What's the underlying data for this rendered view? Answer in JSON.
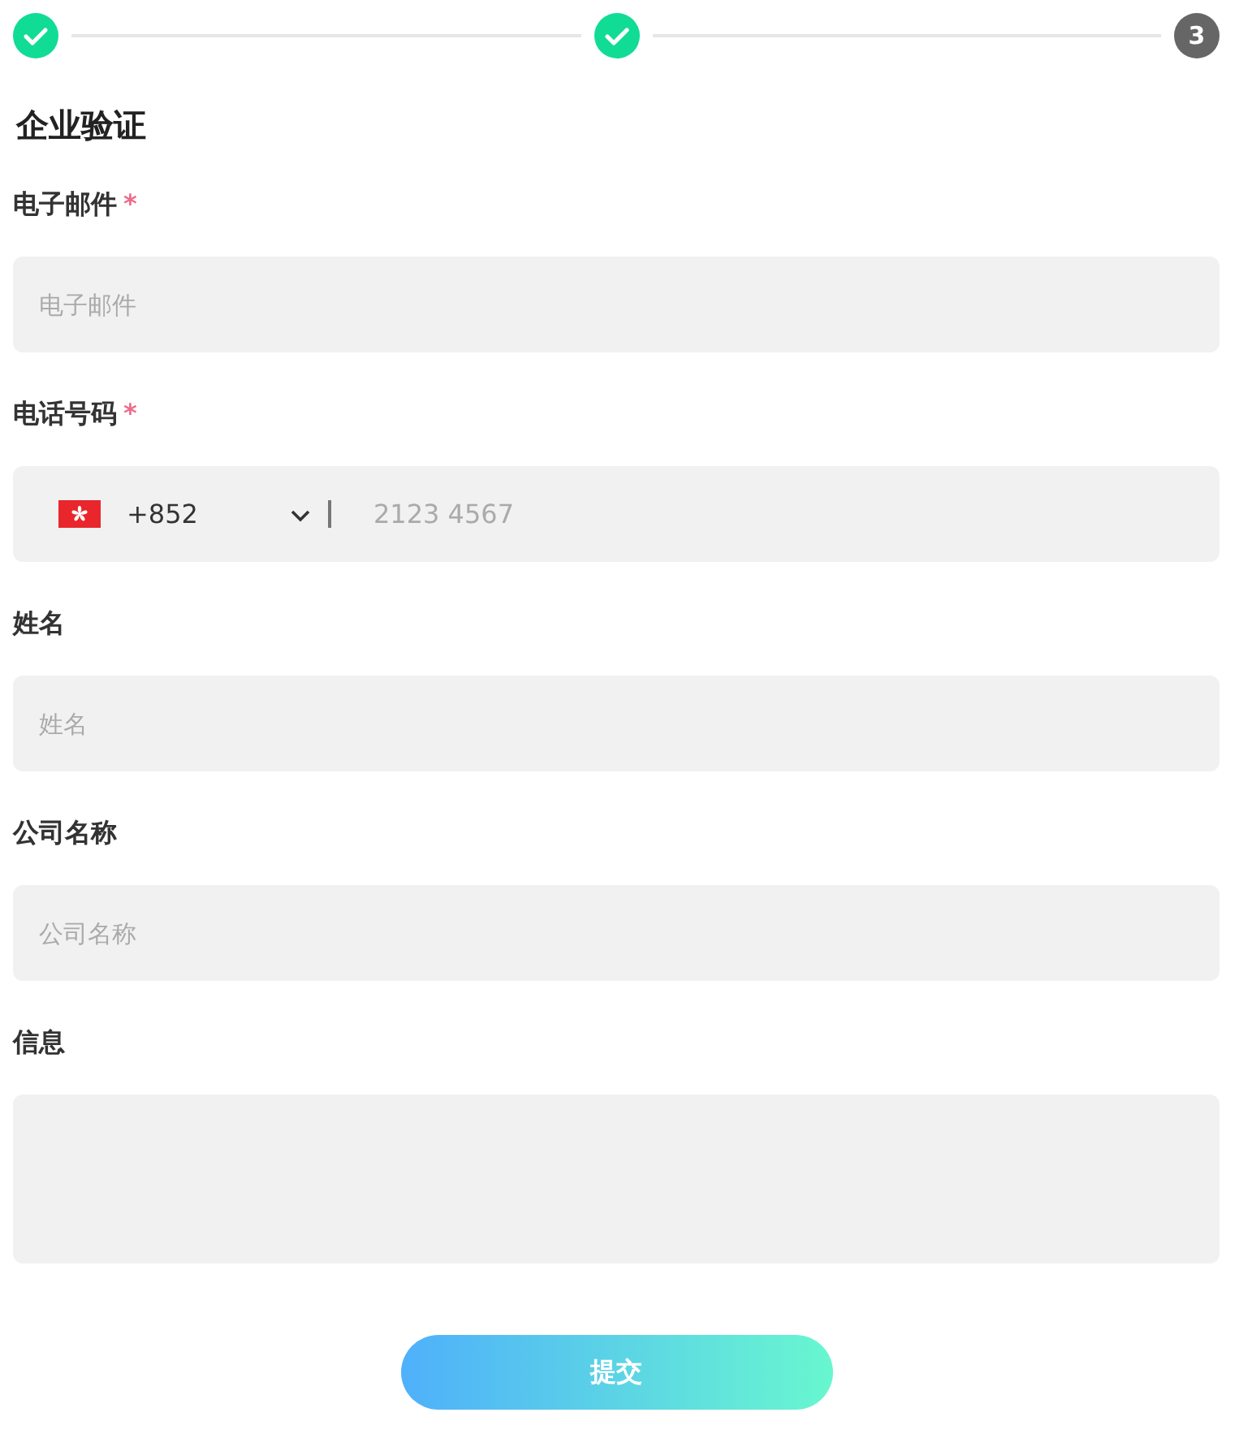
{
  "steps": [
    {
      "completed": true
    },
    {
      "completed": true
    },
    {
      "completed": false,
      "number": "3"
    }
  ],
  "title": "企业验证",
  "fields": [
    {
      "kind": "text",
      "label": "电子邮件",
      "required": true,
      "placeholder": "电子邮件"
    },
    {
      "kind": "phone",
      "label": "电话号码",
      "required": true,
      "country_code": "+852",
      "placeholder": "2123 4567"
    },
    {
      "kind": "text",
      "label": "姓名",
      "required": false,
      "placeholder": "姓名"
    },
    {
      "kind": "text",
      "label": "公司名称",
      "required": false,
      "placeholder": "公司名称"
    },
    {
      "kind": "textarea",
      "label": "信息",
      "required": false
    }
  ],
  "required_mark": "*",
  "submit": "提交"
}
